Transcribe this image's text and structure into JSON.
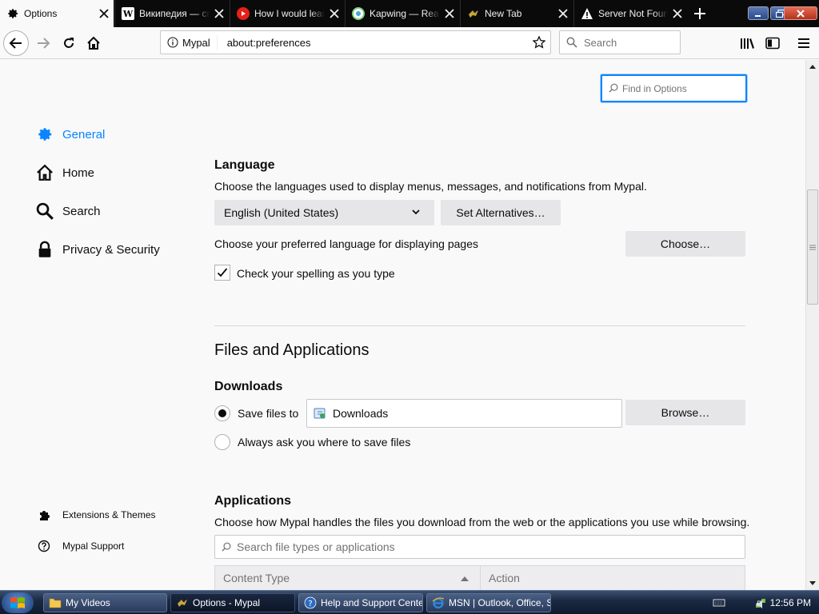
{
  "tabs": [
    {
      "title": "Options",
      "icon": "gear-icon",
      "active": true
    },
    {
      "title": "Википедия — свободная энциклопедия",
      "icon": "wikipedia-icon"
    },
    {
      "title": "How I would learn to code",
      "icon": "youtube-icon"
    },
    {
      "title": "Kapwing — React",
      "icon": "kapwing-icon"
    },
    {
      "title": "New Tab",
      "icon": "mypal-icon"
    },
    {
      "title": "Server Not Found",
      "icon": "warning-icon"
    }
  ],
  "urlbar": {
    "identity_label": "Mypal",
    "url": "about:preferences"
  },
  "searchbar": {
    "placeholder": "Search"
  },
  "find": {
    "placeholder": "Find in Options"
  },
  "categories": [
    {
      "label": "General",
      "icon": "gear-icon",
      "selected": true
    },
    {
      "label": "Home",
      "icon": "home-icon"
    },
    {
      "label": "Search",
      "icon": "search-icon"
    },
    {
      "label": "Privacy & Security",
      "icon": "lock-icon"
    }
  ],
  "footer_links": [
    {
      "label": "Extensions & Themes",
      "icon": "puzzle-icon"
    },
    {
      "label": "Mypal Support",
      "icon": "help-icon"
    }
  ],
  "language": {
    "heading": "Language",
    "description": "Choose the languages used to display menus, messages, and notifications from Mypal.",
    "selected": "English (United States)",
    "alternatives_button": "Set Alternatives…",
    "pages_label": "Choose your preferred language for displaying pages",
    "choose_button": "Choose…",
    "spellcheck_label": "Check your spelling as you type",
    "spellcheck_checked": true
  },
  "files_apps": {
    "heading": "Files and Applications",
    "downloads_heading": "Downloads",
    "save_files_label": "Save files to",
    "download_folder": "Downloads",
    "browse_button": "Browse…",
    "always_ask_label": "Always ask you where to save files",
    "save_selected": true
  },
  "applications": {
    "heading": "Applications",
    "description": "Choose how Mypal handles the files you download from the web or the applications you use while browsing.",
    "filter_placeholder": "Search file types or applications",
    "columns": [
      "Content Type",
      "Action"
    ]
  },
  "taskbar": {
    "tasks": [
      {
        "label": "My Videos",
        "icon": "folder-icon"
      },
      {
        "label": "Options - Mypal",
        "icon": "mypal-icon",
        "active": true
      },
      {
        "label": "Help and Support Center",
        "icon": "help-icon"
      },
      {
        "label": "MSN | Outlook, Office, Skype, Bing",
        "icon": "ie-icon"
      }
    ],
    "clock": "12:56 PM"
  },
  "colors": {
    "accent": "#0a84ff",
    "page_bg": "#f9f9fa",
    "button_bg": "#e6e6e9"
  }
}
